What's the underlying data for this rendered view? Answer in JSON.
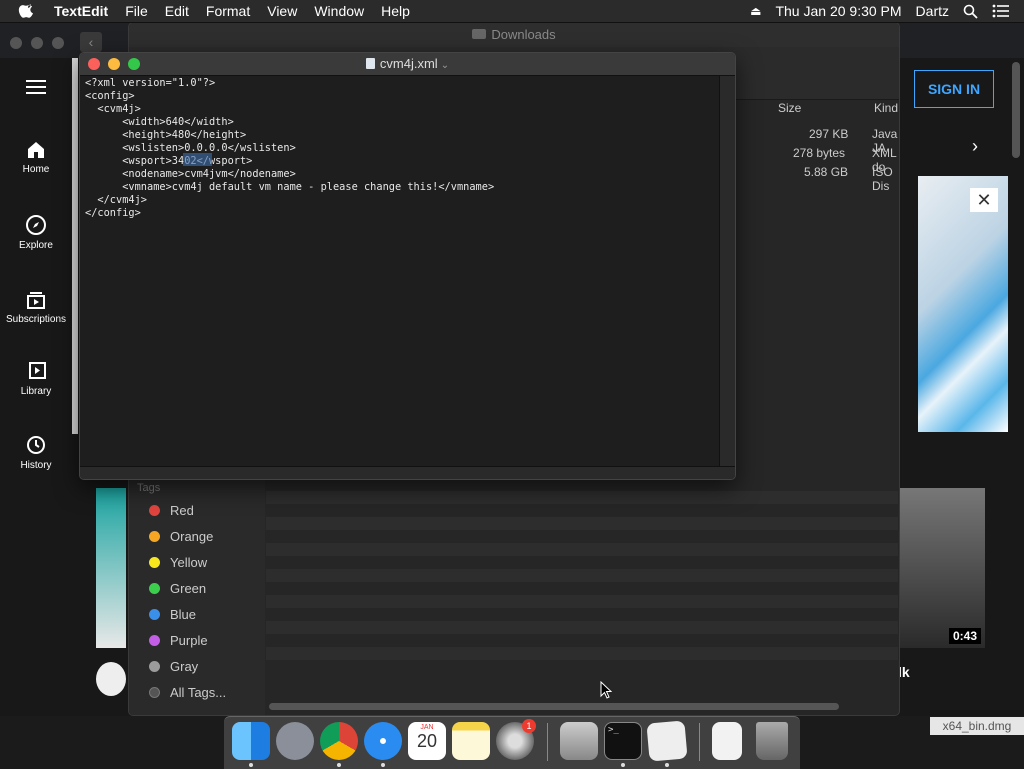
{
  "menubar": {
    "app_name": "TextEdit",
    "items": [
      "File",
      "Edit",
      "Format",
      "View",
      "Window",
      "Help"
    ],
    "datetime": "Thu Jan 20  9:30 PM",
    "user": "Dartz"
  },
  "browser": {
    "sign_in": "SIGN IN"
  },
  "youtube": {
    "nav": [
      "Home",
      "Explore",
      "Subscriptions",
      "Library",
      "History"
    ],
    "video_duration": "0:43",
    "title_fragment": "lk"
  },
  "finder": {
    "title": "Downloads",
    "columns": {
      "size": "Size",
      "kind": "Kind"
    },
    "files": [
      {
        "size": "297 KB",
        "kind": "Java JA"
      },
      {
        "size": "278 bytes",
        "kind": "XML do"
      },
      {
        "size": "5.88 GB",
        "kind": "ISO Dis"
      }
    ],
    "tags_header": "Tags",
    "tags": [
      {
        "label": "Red",
        "color": "#e0443e"
      },
      {
        "label": "Orange",
        "color": "#f5a623"
      },
      {
        "label": "Yellow",
        "color": "#f8e71c"
      },
      {
        "label": "Green",
        "color": "#3ccf4e"
      },
      {
        "label": "Blue",
        "color": "#3a8fe8"
      },
      {
        "label": "Purple",
        "color": "#c55ee6"
      },
      {
        "label": "Gray",
        "color": "#9b9b9b"
      },
      {
        "label": "All Tags...",
        "color": "#555555"
      }
    ]
  },
  "textedit": {
    "filename": "cvm4j.xml",
    "lines": [
      "<?xml version=\"1.0\"?>",
      "<config>",
      "  <cvm4j>",
      "      <width>640</width>",
      "      <height>480</height>",
      "      <wslisten>0.0.0.0</wslisten>",
      "      <wsport>3402</wsport>",
      "      <nodename>cvm4jvm</nodename>",
      "      <vmname>cvm4j default vm name - please change this!</vmname>",
      "  </cvm4j>",
      "</config>"
    ],
    "selected_text": "3402"
  },
  "dock": {
    "calendar_month": "JAN",
    "calendar_day": "20",
    "badge": "1"
  },
  "hover_filename": "x64_bin.dmg"
}
